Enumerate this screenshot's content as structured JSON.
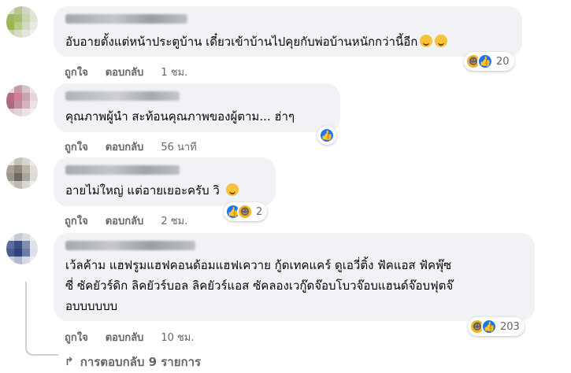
{
  "comments": [
    {
      "text": "อับอายตั้งแต่หน้าประตูบ้าน เดี๋ยวเข้าบ้านไปคุยกับพ่อบ้านหนักกว่านี้อีก",
      "like_label": "ถูกใจ",
      "reply_label": "ตอบกลับ",
      "time": "1 ชม.",
      "reaction_count": "20",
      "reaction_icons": [
        "haha-icon",
        "like-icon"
      ]
    },
    {
      "text": "คุณภาพผู้นำ สะท้อนคุณภาพของผู้ตาม... ฮ่าๆ",
      "like_label": "ถูกใจ",
      "reply_label": "ตอบกลับ",
      "time": "56 นาที",
      "reaction_icons": [
        "like-icon"
      ]
    },
    {
      "text": "อายไม่ใหญ่ แต่อายเยอะครับ วิ",
      "like_label": "ถูกใจ",
      "reply_label": "ตอบกลับ",
      "time": "2 ชม.",
      "reaction_count": "2",
      "reaction_icons": [
        "like-icon",
        "haha-icon"
      ]
    },
    {
      "lines": [
        "เว้ลค้าม แฮฟรูมแฮฟคอนด้อมแฮฟเควาย กู้ดเทคแคร์ ดูเอวี่ติ้ง ฟัคแอส ฟัคพุ๊ซ",
        "ซี่ ซัคยัวร์ดิก ลิคยัวร์บอล ลิคยัวร์แอส ซัคลองเวกู๊ดจ๊อบโบวจ๊อบแฮนด์จ๊อบฟุตจ๊",
        "อบบบบบบ"
      ],
      "like_label": "ถูกใจ",
      "reply_label": "ตอบกลับ",
      "time": "10 ชม.",
      "reaction_count": "203",
      "reaction_icons": [
        "haha-icon",
        "like-icon"
      ]
    }
  ],
  "replies_link": "การตอบกลับ 9 รายการ",
  "colors": {
    "like": "#1877f2",
    "haha": "#f7b125",
    "bubble": "#f0f2f5",
    "meta": "#65676b"
  }
}
